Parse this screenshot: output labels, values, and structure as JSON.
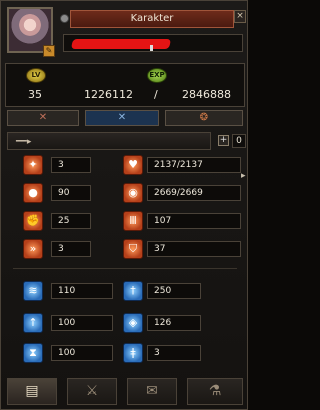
{
  "window": {
    "title": "Karakter",
    "close_glyph": "×"
  },
  "level": {
    "badge": "LV",
    "value": "35"
  },
  "exp": {
    "badge": "EXP",
    "current": "1226112",
    "separator": "/",
    "max": "2846888"
  },
  "weapon_slot": {
    "count": "0"
  },
  "stats_left": [
    {
      "icon": "strength-icon",
      "value": "3"
    },
    {
      "icon": "head-icon",
      "value": "90"
    },
    {
      "icon": "arm-icon",
      "value": "25"
    },
    {
      "icon": "speed-icon",
      "value": "3"
    }
  ],
  "stats_right": [
    {
      "icon": "heart-icon",
      "value": "2137/2137"
    },
    {
      "icon": "mana-orb-icon",
      "value": "2669/2669"
    },
    {
      "icon": "pillar-icon",
      "value": "107"
    },
    {
      "icon": "shield-icon",
      "value": "37"
    }
  ],
  "combat_left": [
    {
      "icon": "wing-icon",
      "value": "110"
    },
    {
      "icon": "sword-up-icon",
      "value": "100"
    },
    {
      "icon": "hourglass-icon",
      "value": "100"
    }
  ],
  "combat_right": [
    {
      "icon": "dagger-icon",
      "value": "250"
    },
    {
      "icon": "guard-icon",
      "value": "126"
    },
    {
      "icon": "bolt-icon",
      "value": "3"
    }
  ],
  "colors": {
    "title_bar": "#5a2214",
    "tab_active": "#1c3350",
    "stat_red": "#b5401a",
    "stat_blue": "#2a6cb8",
    "redaction": "#e51414"
  }
}
